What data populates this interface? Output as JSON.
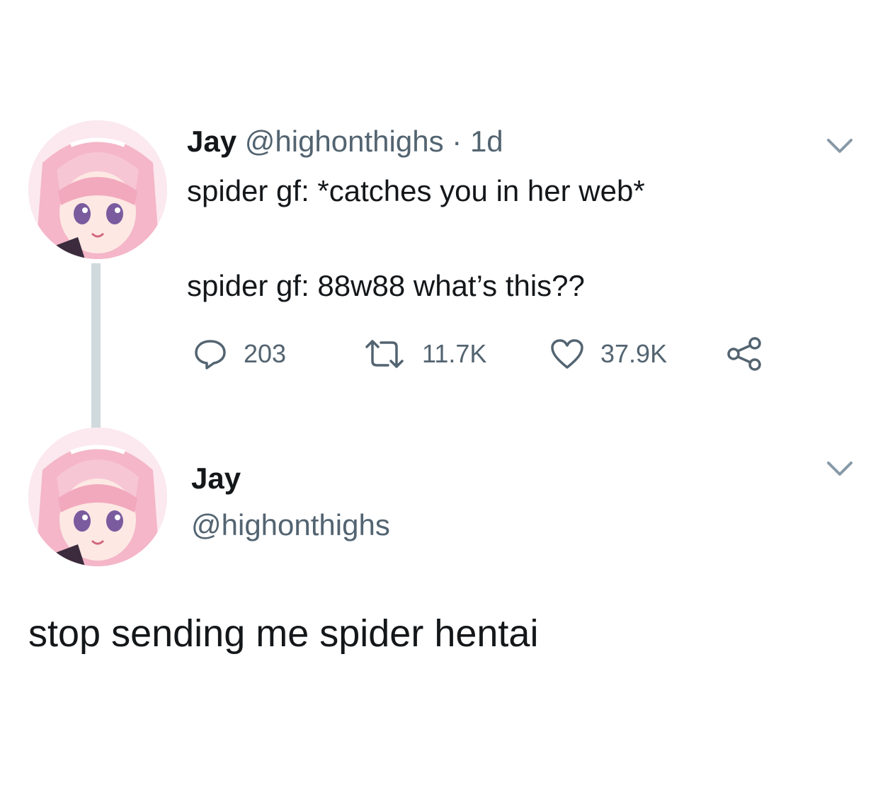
{
  "tweet": {
    "name": "Jay",
    "handle": "@highonthighs",
    "separator": "·",
    "time": "1d",
    "line1": "spider gf: *catches you in her web*",
    "line2": "spider gf: 88w88 what’s this??",
    "actions": {
      "replies": "203",
      "retweets": "11.7K",
      "likes": "37.9K"
    }
  },
  "reply": {
    "name": "Jay",
    "handle": "@highonthighs",
    "text": "stop sending me spider hentai"
  },
  "icons": {
    "reply": "speech-bubble-icon",
    "retweet": "retweet-icon",
    "like": "heart-icon",
    "share": "share-icon",
    "more": "chevron-down-icon"
  },
  "colors": {
    "text": "#14171a",
    "muted": "#536471",
    "thread_line": "#cfd9de"
  }
}
